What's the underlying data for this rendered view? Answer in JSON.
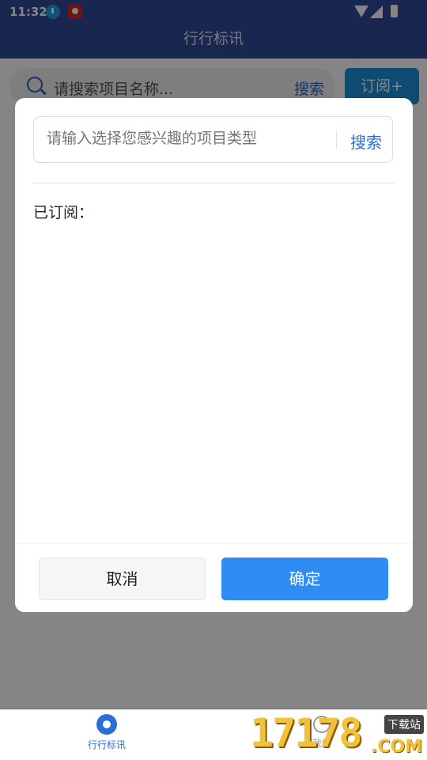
{
  "status_bar": {
    "time": "11:32",
    "icons": [
      "download-icon",
      "app-icon",
      "wifi-icon",
      "signal-icon",
      "battery-icon"
    ]
  },
  "header": {
    "title": "行行标讯"
  },
  "search": {
    "placeholder": "请搜索项目名称...",
    "button_label": "搜索"
  },
  "subscribe_button": "订阅+",
  "dialog": {
    "search_placeholder": "请输入选择您感兴趣的项目类型",
    "search_button": "搜索",
    "subscribed_label": "已订阅：",
    "cancel_label": "取消",
    "confirm_label": "确定"
  },
  "bottom_nav": {
    "items": [
      {
        "label": "行行标讯",
        "icon": "target-icon",
        "active": true
      },
      {
        "label": "我的",
        "icon": "user-icon",
        "active": false
      }
    ]
  },
  "watermark": {
    "number": "17178",
    "tag": "下载站",
    "domain": ".COM"
  },
  "colors": {
    "header": "#2f4a9a",
    "accent": "#2f8cf5",
    "link": "#2b6fd6"
  }
}
